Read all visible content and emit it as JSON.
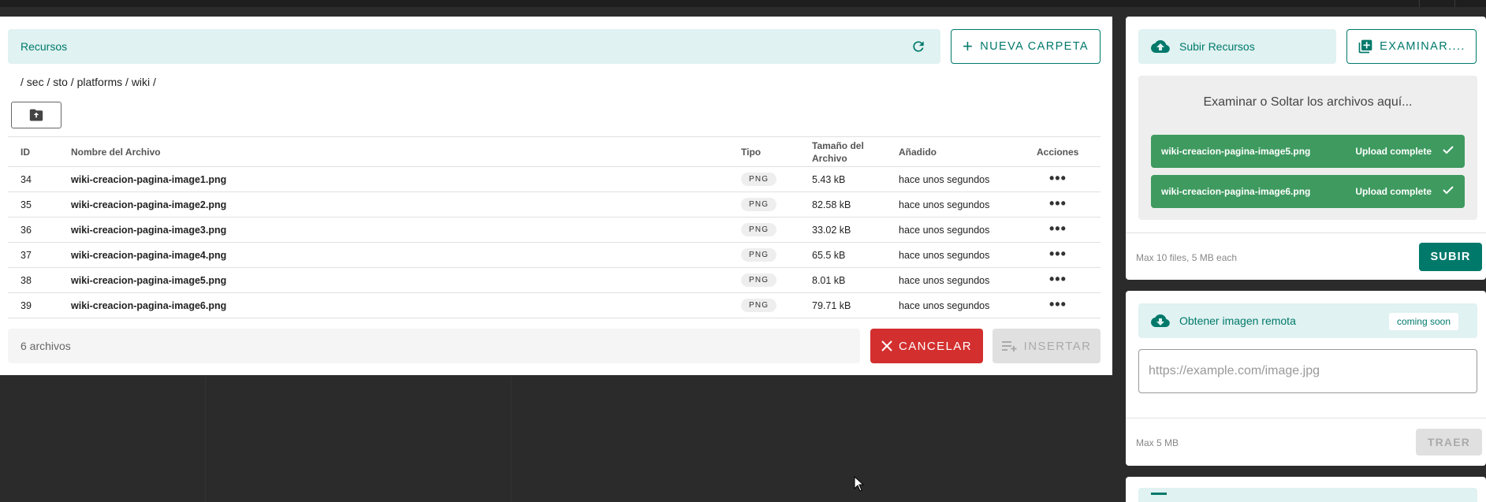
{
  "resources": {
    "title": "Recursos",
    "new_folder_label": "NUEVA CARPETA",
    "breadcrumb": "/ sec / sto / platforms / wiki /"
  },
  "table": {
    "headers": {
      "id": "ID",
      "name": "Nombre del Archivo",
      "type": "Tipo",
      "size": "Tamaño del Archivo",
      "added": "Añadido",
      "actions": "Acciones"
    },
    "rows": [
      {
        "id": "34",
        "name": "wiki-creacion-pagina-image1.png",
        "type": "PNG",
        "size": "5.43 kB",
        "added": "hace unos segundos"
      },
      {
        "id": "35",
        "name": "wiki-creacion-pagina-image2.png",
        "type": "PNG",
        "size": "82.58 kB",
        "added": "hace unos segundos"
      },
      {
        "id": "36",
        "name": "wiki-creacion-pagina-image3.png",
        "type": "PNG",
        "size": "33.02 kB",
        "added": "hace unos segundos"
      },
      {
        "id": "37",
        "name": "wiki-creacion-pagina-image4.png",
        "type": "PNG",
        "size": "65.5 kB",
        "added": "hace unos segundos"
      },
      {
        "id": "38",
        "name": "wiki-creacion-pagina-image5.png",
        "type": "PNG",
        "size": "8.01 kB",
        "added": "hace unos segundos"
      },
      {
        "id": "39",
        "name": "wiki-creacion-pagina-image6.png",
        "type": "PNG",
        "size": "79.71 kB",
        "added": "hace unos segundos"
      }
    ]
  },
  "footer": {
    "count": "6 archivos",
    "cancel_label": "CANCELAR",
    "insert_label": "INSERTAR"
  },
  "upload": {
    "title": "Subir Recursos",
    "browse_label": "EXAMINAR....",
    "drop_text": "Examinar o Soltar los archivos aquí...",
    "files": [
      {
        "name": "wiki-creacion-pagina-image5.png",
        "status": "Upload complete"
      },
      {
        "name": "wiki-creacion-pagina-image6.png",
        "status": "Upload complete"
      }
    ],
    "hint": "Max 10 files, 5 MB each",
    "submit_label": "SUBIR"
  },
  "remote": {
    "title": "Obtener imagen remota",
    "badge": "coming soon",
    "placeholder": "https://example.com/image.jpg",
    "hint": "Max 5 MB",
    "fetch_label": "TRAER"
  },
  "colors": {
    "accent": "#00796b",
    "accent_light": "#e0f2f1",
    "danger": "#d32f2f",
    "success": "#3e9a5f"
  }
}
